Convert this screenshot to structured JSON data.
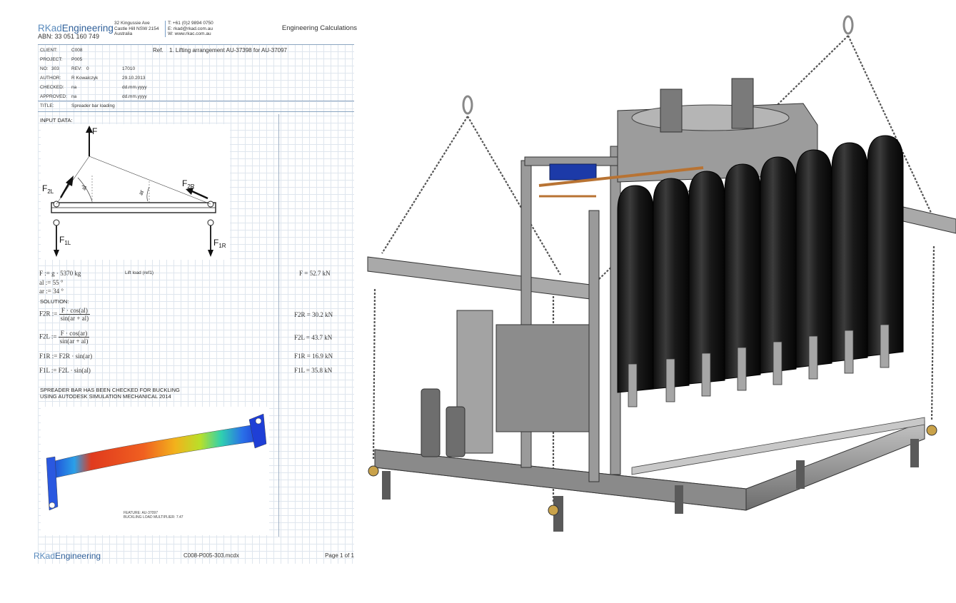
{
  "header": {
    "logo_prefix": "RKad",
    "logo_suffix": "Engineering",
    "abn": "ABN: 33 051 160 749",
    "address": [
      "32 Kingussie Ave",
      "Castle Hill NSW 2154",
      "Australia"
    ],
    "contact": [
      "T: +61 (0)2 9894 0750",
      "E: rkad@rkad.com.au",
      "W: www.rkac.com.au"
    ],
    "title_right": "Engineering Calculations"
  },
  "meta": {
    "client_label": "CLIENT:",
    "client_value": "C008",
    "ref_label": "Ref.",
    "ref_value": "1. Lifting arrangement AU-37398 for AU-37097",
    "project_label": "PROJECT:",
    "project_value": "P005",
    "no_label": "NO:",
    "no_value": "303",
    "rev_label": "REV:",
    "rev_value": "0",
    "rev_date": "17010",
    "author_label": "AUTHOR:",
    "author_value": "R Kowalczyk",
    "author_date": "29.10.2013",
    "checked_label": "CHECKED:",
    "checked_value": "na",
    "checked_date": "dd.mm.yyyy",
    "approved_label": "APPROVED:",
    "approved_value": "na",
    "approved_date": "dd.mm.yyyy",
    "title_label": "TITLE:",
    "title_value": "Spreader bar loading"
  },
  "input_data_label": "INPUT DATA:",
  "diagram": {
    "f": "F",
    "f2l": "F2L",
    "f2r": "F2R",
    "f1l": "F1L",
    "f1r": "F1R",
    "al": "al",
    "ar": "ar"
  },
  "inputs": {
    "f_def": "F := g · 5370 kg",
    "f_comment": "Lift load (ref1)",
    "al_def": "al := 55 °",
    "ar_def": "ar := 34 °",
    "f_result": "F = 52.7 kN"
  },
  "solution_label": "SOLUTION:",
  "equations": [
    {
      "lhs": "F2R :=",
      "num": "F · cos(al)",
      "den": "sin(ar + al)",
      "result": "F2R = 30.2 kN"
    },
    {
      "lhs": "F2L :=",
      "num": "F · cos(ar)",
      "den": "sin(ar + al)",
      "result": "F2L = 43.7 kN"
    },
    {
      "lhs": "F1R := F2R · sin(ar)",
      "result": "F1R = 16.9 kN"
    },
    {
      "lhs": "F1L := F2L · sin(al)",
      "result": "F1L = 35.8 kN"
    }
  ],
  "note_lines": [
    "SPREADER BAR HAS BEEN CHECKED FOR BUCKLING",
    "USING AUTODESK SIMULATION MECHANICAL 2014"
  ],
  "fea_caption": [
    "FEATURE: AU-37097",
    "BUCKLING LOAD MULTIPLIER: 7.47"
  ],
  "footer": {
    "logo_prefix": "RKad",
    "logo_suffix": "Engineering",
    "file": "C008-P005-303.mcdx",
    "page": "Page 1 of 1"
  },
  "colors": {
    "brand_light": "#5a8bbd",
    "brand_dark": "#2f5f99",
    "result_unit": "#b13a3a"
  }
}
